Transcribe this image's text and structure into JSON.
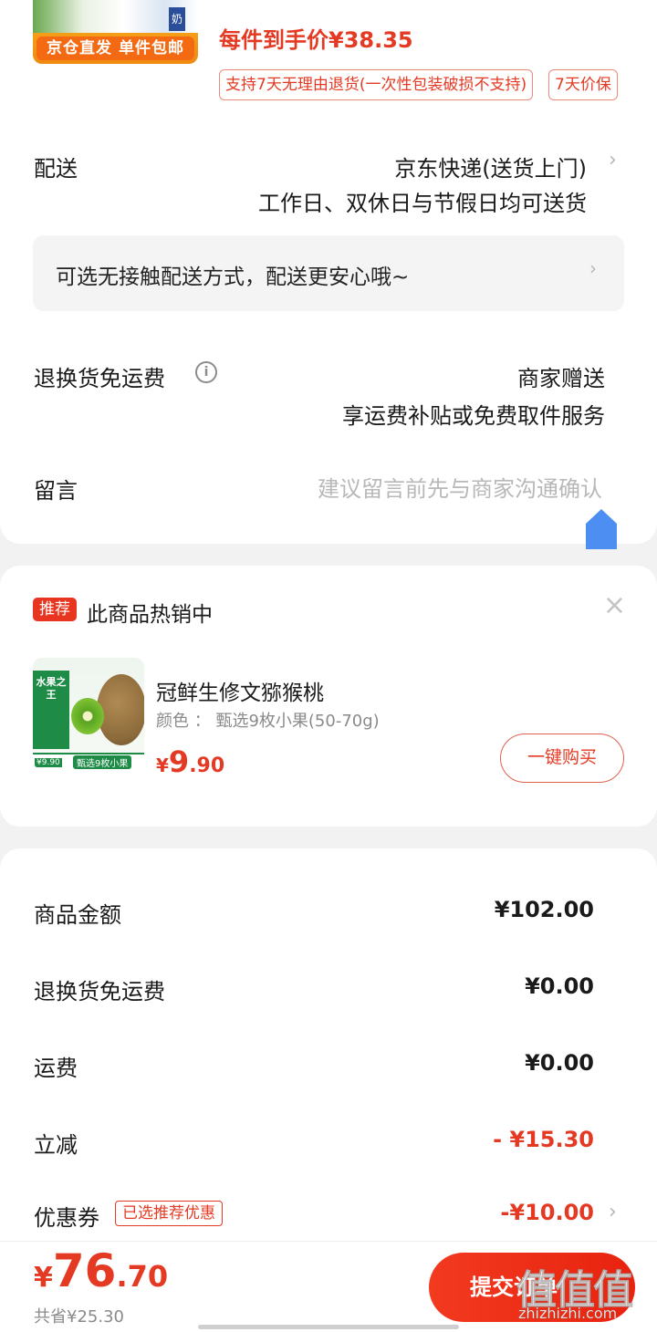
{
  "order": {
    "thumb_banner": "京仓直发 单件包邮",
    "thumb_box_text": "奶",
    "unit_price_label": "每件到手价¥38.35",
    "tag_return": "支持7天无理由退货(一次性包装破损不支持)",
    "tag_price_protect": "7天价保"
  },
  "delivery": {
    "label": "配送",
    "method": "京东快递(送货上门)",
    "schedule": "工作日、双休日与节假日均可送货",
    "chevron": "›"
  },
  "contactless": {
    "text": "可选无接触配送方式，配送更安心哦~",
    "chevron": "›"
  },
  "return_shipping": {
    "label": "退换货免运费",
    "info_icon": "i",
    "value": "商家赠送",
    "desc": "享运费补贴或免费取件服务"
  },
  "message": {
    "label": "留言",
    "placeholder": "建议留言前先与商家沟通确认"
  },
  "recommend": {
    "badge": "推荐",
    "title": "此商品热销中",
    "close": "×",
    "product": {
      "image_text_top": "水果之王",
      "image_text_bottom": "甄选9枚小果",
      "image_price": "¥9.90",
      "name": "冠鲜生修文猕猴桃",
      "spec": "颜色 ： 甄选9枚小果(50-70g)",
      "price_currency": "¥",
      "price_int": "9",
      "price_dec": ".90",
      "buy_label": "一键购买"
    }
  },
  "summary": {
    "rows": [
      {
        "label": "商品金额",
        "value": "¥102.00"
      },
      {
        "label": "退换货免运费",
        "value": "¥0.00"
      },
      {
        "label": "运费",
        "value": "¥0.00"
      },
      {
        "label": "立减",
        "value": "- ¥15.30"
      },
      {
        "label": "优惠券",
        "value": "-¥10.00"
      }
    ],
    "coupon_tag": "已选推荐优惠",
    "coupon_chevron": "›"
  },
  "footer": {
    "total_currency": "¥",
    "total_int": "76",
    "total_dec": ".70",
    "saved": "共省¥25.30",
    "submit": "提交订单"
  },
  "watermark": {
    "logo": "值值值",
    "domain": "zhizhizhi.com"
  },
  "colors": {
    "accent": "#e43a23",
    "button_gradient_start": "#f23a1f",
    "home_button": "#4d8ef2"
  }
}
